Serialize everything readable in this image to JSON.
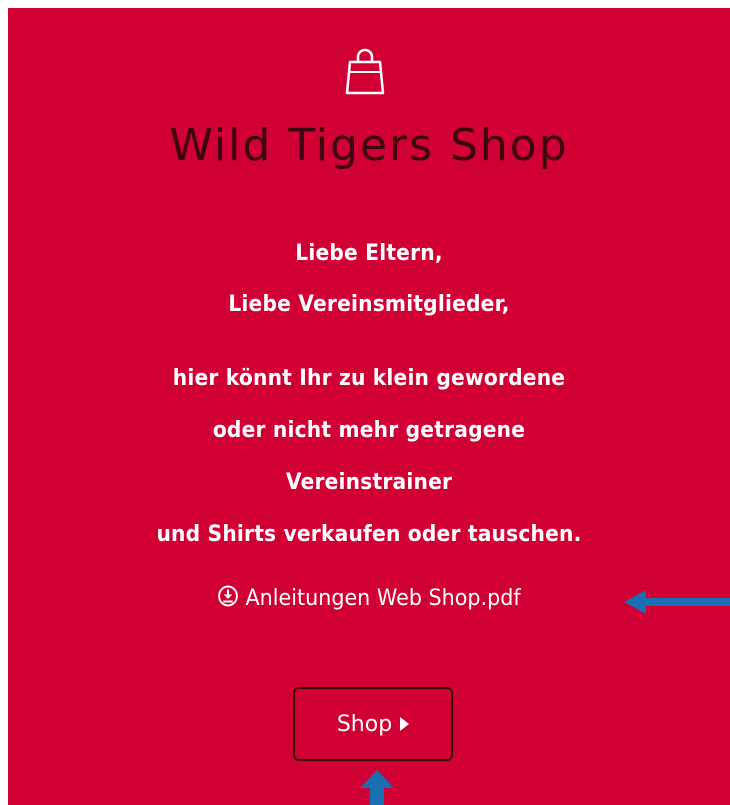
{
  "shop": {
    "title": "Wild Tigers Shop",
    "icon": "shopping-bag-icon",
    "colors": {
      "background": "#d10034",
      "title": "#3b0610",
      "text": "#ffffff",
      "annotation_arrow": "#1a6fb3"
    }
  },
  "greeting": {
    "line1": "Liebe Eltern,",
    "line2": "Liebe Vereinsmitglieder,"
  },
  "message": {
    "line1": "hier könnt Ihr zu klein gewordene",
    "line2": "oder nicht mehr getragene",
    "line3": "Vereinstrainer",
    "line4": "und Shirts verkaufen oder tauschen."
  },
  "download": {
    "icon": "download-circle-icon",
    "label": "Anleitungen Web Shop.pdf"
  },
  "shop_button": {
    "label": "Shop",
    "icon": "caret-right-icon"
  }
}
